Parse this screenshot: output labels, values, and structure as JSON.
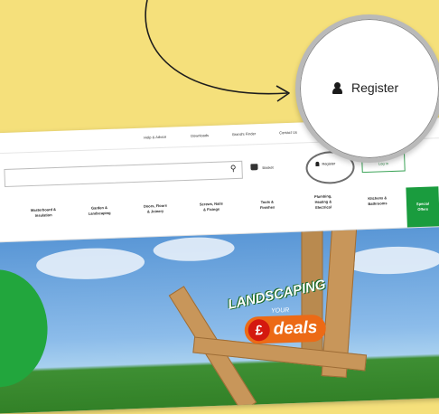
{
  "util_links": [
    "Help & Advice",
    "Downloads",
    "Brand's Finder",
    "Contact Us"
  ],
  "header": {
    "search_placeholder": "",
    "basket_label": "Basket",
    "register_label": "Register",
    "login_label": "Log in"
  },
  "nav": [
    "Masterboard &\nInsulation",
    "Garden &\nLandscaping",
    "Doors, Floors\n& Joinery",
    "Screws, Nails\n& Fixings",
    "Tools &\nFinishes",
    "Plumbing,\nHeating &\nElectrical",
    "Kitchens &\nBathrooms"
  ],
  "nav_special": "Special\nOffers",
  "hero": {
    "headline": "LANDSCAPING",
    "sub": "YOUR",
    "currency": "£",
    "deals": "deals"
  },
  "magnifier": {
    "label": "Register"
  },
  "colors": {
    "background": "#f5e07b",
    "accent_green": "#1a9c3e",
    "deals_orange": "#ec6a16"
  }
}
